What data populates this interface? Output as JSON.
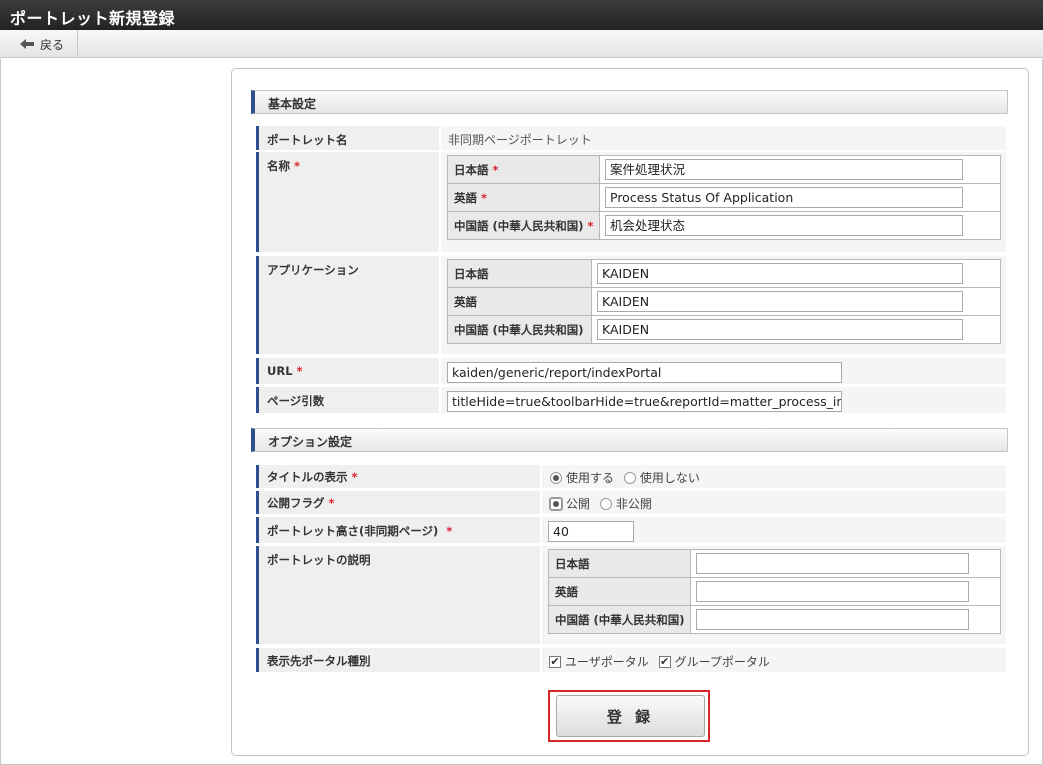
{
  "title": "ポートレット新規登録",
  "toolbar": {
    "back_label": "戻る"
  },
  "basic": {
    "heading": "基本設定",
    "portlet_name": {
      "label": "ポートレット名",
      "value": "非同期ページポートレット"
    },
    "name": {
      "label": "名称",
      "rows": [
        {
          "lang": "日本語",
          "value": "案件処理状況"
        },
        {
          "lang": "英語",
          "value": "Process Status Of Application"
        },
        {
          "lang": "中国語 (中華人民共和国)",
          "value": "机会处理状态"
        }
      ]
    },
    "application": {
      "label": "アプリケーション",
      "rows": [
        {
          "lang": "日本語",
          "value": "KAIDEN"
        },
        {
          "lang": "英語",
          "value": "KAIDEN"
        },
        {
          "lang": "中国語 (中華人民共和国)",
          "value": "KAIDEN"
        }
      ]
    },
    "url": {
      "label": "URL",
      "value": "kaiden/generic/report/indexPortal"
    },
    "page_args": {
      "label": "ページ引数",
      "value": "titleHide=true&toolbarHide=true&reportId=matter_process_info"
    }
  },
  "options": {
    "heading": "オプション設定",
    "title_display": {
      "label": "タイトルの表示",
      "opt_use": "使用する",
      "opt_nouse": "使用しない",
      "selected": "使用する"
    },
    "public_flag": {
      "label": "公開フラグ",
      "opt_public": "公開",
      "opt_private": "非公開",
      "selected": "公開"
    },
    "height": {
      "label": "ポートレット高さ(非同期ページ)",
      "value": "40"
    },
    "description": {
      "label": "ポートレットの説明",
      "rows": [
        {
          "lang": "日本語",
          "value": ""
        },
        {
          "lang": "英語",
          "value": ""
        },
        {
          "lang": "中国語 (中華人民共和国)",
          "value": ""
        }
      ]
    },
    "portal_type": {
      "label": "表示先ポータル種別",
      "opt_user": "ユーザポータル",
      "opt_group": "グループポータル",
      "user_checked": true,
      "group_checked": true
    }
  },
  "required_mark": "*",
  "submit_label": "登 録",
  "colors": {
    "accent": "#2f4f8f",
    "required": "#d9262c",
    "highlight_border": "#d9262c"
  },
  "icons": {
    "back": "arrow-left-icon"
  }
}
